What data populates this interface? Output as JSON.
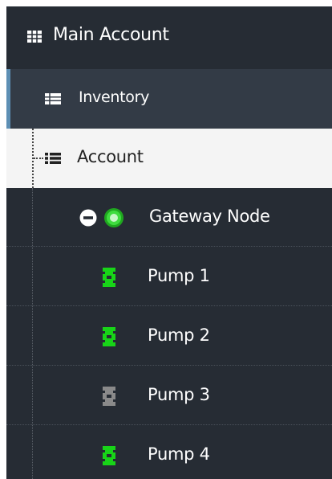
{
  "tree": {
    "main_account": {
      "label": "Main Account",
      "icon": "grid-icon"
    },
    "inventory": {
      "label": "Inventory",
      "icon": "table-icon"
    },
    "account": {
      "label": "Account",
      "icon": "list-icon"
    },
    "gateway_node": {
      "label": "Gateway Node",
      "icon": "gateway-status-icon",
      "status_color": "#2bd02b"
    },
    "pumps": [
      {
        "label": "Pump 1",
        "icon": "pump-icon",
        "status_color": "#18d418"
      },
      {
        "label": "Pump 2",
        "icon": "pump-icon",
        "status_color": "#18d418"
      },
      {
        "label": "Pump 3",
        "icon": "pump-icon",
        "status_color": "#8a8a8a"
      },
      {
        "label": "Pump 4",
        "icon": "pump-icon",
        "status_color": "#18d418"
      }
    ]
  },
  "colors": {
    "panel_bg": "#262c34",
    "selected_bg": "#333b46",
    "selected_accent": "#5d8fb4",
    "account_bg": "#f4f4f4"
  }
}
